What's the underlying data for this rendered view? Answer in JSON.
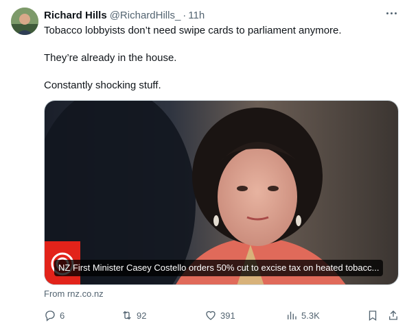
{
  "tweet": {
    "author_name": "Richard Hills",
    "handle": "@RichardHills_",
    "separator": "·",
    "time": "11h",
    "lines": [
      "Tobacco lobbyists don’t need swipe cards to parliament anymore.",
      "They’re already in the house.",
      "Constantly shocking stuff."
    ]
  },
  "media": {
    "caption": "NZ First Minister Casey Costello orders 50% cut to excise tax on heated tobacc...",
    "source": "From rnz.co.nz"
  },
  "actions": {
    "replies": "6",
    "reposts": "92",
    "likes": "391",
    "views": "5.3K"
  },
  "icons": {
    "more": "more-icon",
    "reply": "reply-icon",
    "repost": "repost-icon",
    "like": "heart-icon",
    "views": "views-icon",
    "bookmark": "bookmark-icon",
    "share": "share-icon"
  },
  "colors": {
    "text_primary": "#0f1419",
    "text_secondary": "#536471",
    "rnz_red": "#e2231a"
  }
}
